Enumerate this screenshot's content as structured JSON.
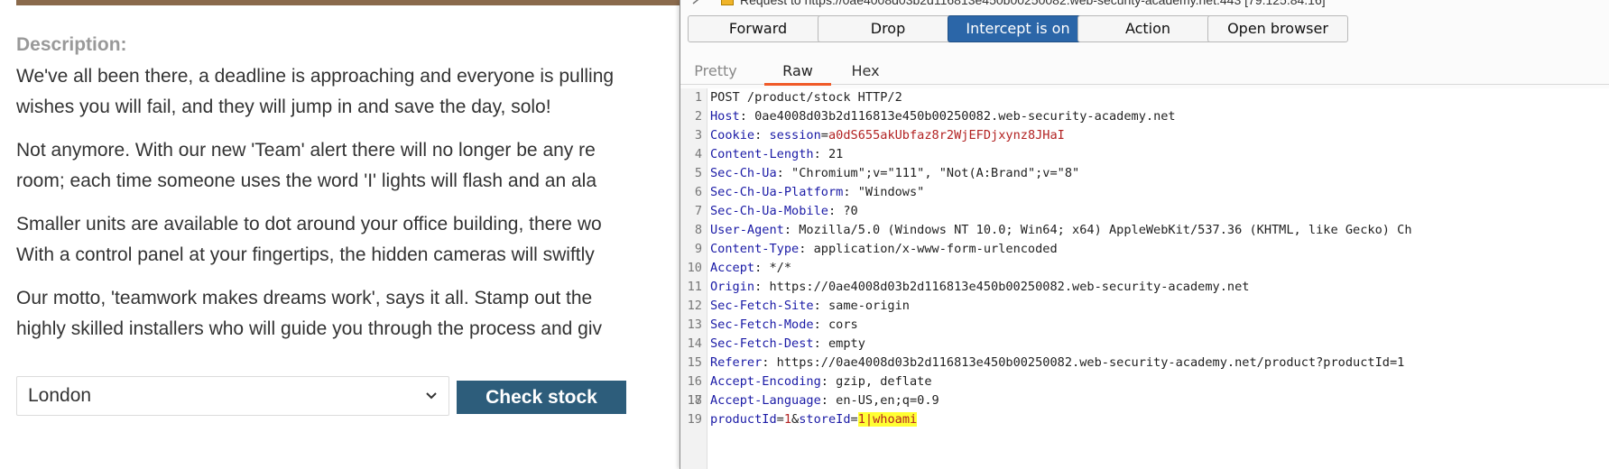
{
  "page": {
    "description_label": "Description:",
    "paragraphs": [
      [
        "We've all been there, a deadline is approaching and everyone is pulling",
        "wishes you will fail, and they will jump in and save the day, solo!"
      ],
      [
        "Not anymore. With our new 'Team' alert there will no longer be any re",
        "room; each time someone uses the word 'I' lights will flash and an ala"
      ],
      [
        "Smaller units are available to dot around your office building, there wo",
        "With a control panel at your fingertips, the hidden cameras will swiftly"
      ],
      [
        "Our motto, 'teamwork makes dreams work', says it all. Stamp out the",
        "highly skilled installers who will guide you through the process and giv"
      ]
    ],
    "store_select": {
      "value": "London",
      "icon": "chevron-down-icon"
    },
    "check_stock_label": "Check stock",
    "colors": {
      "check_button": "#2d5d7b",
      "label_grey": "#999999",
      "text": "#333333"
    }
  },
  "burp": {
    "title": "Request to https://0ae4008d03b2d116813e450b00250082.web-security-academy.net:443 [79.125.84.16]",
    "buttons": {
      "forward": "Forward",
      "drop": "Drop",
      "intercept": "Intercept is on",
      "action": "Action",
      "open_browser": "Open browser"
    },
    "tabs": {
      "pretty": "Pretty",
      "raw": "Raw",
      "hex": "Hex"
    },
    "request": {
      "request_line": "POST /product/stock HTTP/2",
      "headers": [
        {
          "n": "2",
          "name": "Host",
          "value": "0ae4008d03b2d116813e450b00250082.web-security-academy.net"
        },
        {
          "n": "3",
          "name": "Cookie",
          "cookie_name": "session",
          "cookie_value": "a0dS655akUbfaz8r2WjEFDjxynz8JHaI"
        },
        {
          "n": "4",
          "name": "Content-Length",
          "value": "21"
        },
        {
          "n": "5",
          "name": "Sec-Ch-Ua",
          "value": "\"Chromium\";v=\"111\", \"Not(A:Brand\";v=\"8\""
        },
        {
          "n": "6",
          "name": "Sec-Ch-Ua-Platform",
          "value": "\"Windows\""
        },
        {
          "n": "7",
          "name": "Sec-Ch-Ua-Mobile",
          "value": "?0"
        },
        {
          "n": "8",
          "name": "User-Agent",
          "value": "Mozilla/5.0 (Windows NT 10.0; Win64; x64) AppleWebKit/537.36 (KHTML, like Gecko) Ch"
        },
        {
          "n": "9",
          "name": "Content-Type",
          "value": "application/x-www-form-urlencoded"
        },
        {
          "n": "10",
          "name": "Accept",
          "value": "*/*"
        },
        {
          "n": "11",
          "name": "Origin",
          "value": "https://0ae4008d03b2d116813e450b00250082.web-security-academy.net"
        },
        {
          "n": "12",
          "name": "Sec-Fetch-Site",
          "value": "same-origin"
        },
        {
          "n": "13",
          "name": "Sec-Fetch-Mode",
          "value": "cors"
        },
        {
          "n": "14",
          "name": "Sec-Fetch-Dest",
          "value": "empty"
        },
        {
          "n": "15",
          "name": "Referer",
          "value": "https://0ae4008d03b2d116813e450b00250082.web-security-academy.net/product?productId=1"
        },
        {
          "n": "16",
          "name": "Accept-Encoding",
          "value": "gzip, deflate"
        },
        {
          "n": "17",
          "name": "Accept-Language",
          "value": "en-US,en;q=0.9"
        }
      ],
      "body": {
        "n": "19",
        "p1_name": "productId",
        "p1_value": "1",
        "p2_name": "storeId",
        "p2_value": "1|whoami"
      }
    },
    "colors": {
      "intercept_on": "#2b66a8",
      "active_tab_underline": "#f05a28",
      "highlight": "#ffff33",
      "header_name": "#1a1aa6",
      "cookie_value": "#b22222"
    }
  }
}
